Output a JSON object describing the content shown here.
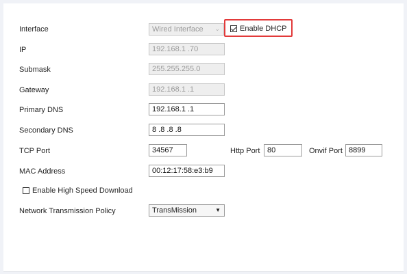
{
  "form": {
    "interface": {
      "label": "Interface",
      "value": "Wired Interface"
    },
    "dhcp": {
      "label": "Enable DHCP",
      "checked": true
    },
    "ip": {
      "label": "IP",
      "value": "192.168.1  .70"
    },
    "submask": {
      "label": "Submask",
      "value": "255.255.255.0"
    },
    "gateway": {
      "label": "Gateway",
      "value": "192.168.1  .1"
    },
    "primary_dns": {
      "label": "Primary DNS",
      "value": "192.168.1  .1"
    },
    "secondary_dns": {
      "label": "Secondary DNS",
      "value": "8  .8  .8  .8"
    },
    "tcp_port": {
      "label": "TCP Port",
      "value": "34567"
    },
    "http_port": {
      "label": "Http Port",
      "value": "80"
    },
    "onvif_port": {
      "label": "Onvif Port",
      "value": "8899"
    },
    "mac": {
      "label": "MAC Address",
      "value": "00:12:17:58:e3:b9"
    },
    "high_speed": {
      "label": "Enable High Speed Download",
      "checked": false
    },
    "policy": {
      "label": "Network Transmission Policy",
      "value": "TransMission"
    }
  },
  "colors": {
    "highlight": "#e23a3a",
    "page_background": "#f0f2f7"
  }
}
